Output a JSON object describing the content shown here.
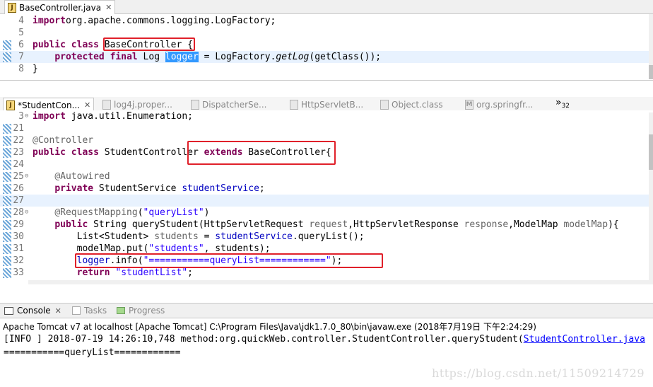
{
  "top_editor": {
    "tab_label": "BaseController.java",
    "lines": [
      {
        "num": "4",
        "parts": [
          [
            "kw",
            "import"
          ],
          [
            "",
            "org.apache.commons.logging.LogFactory;"
          ]
        ]
      },
      {
        "num": "5",
        "parts": []
      },
      {
        "num": "6",
        "parts": [
          [
            "kw",
            "public"
          ],
          [
            "",
            " "
          ],
          [
            "kw",
            "class"
          ],
          [
            "",
            " BaseController {"
          ]
        ]
      },
      {
        "num": "7",
        "parts": [
          [
            "",
            "    "
          ],
          [
            "kw",
            "protected"
          ],
          [
            "",
            " "
          ],
          [
            "kw",
            "final"
          ],
          [
            "",
            " Log "
          ],
          [
            "sel",
            "logger"
          ],
          [
            "",
            " = LogFactory."
          ],
          [
            "it",
            "getLog"
          ],
          [
            "",
            "(getClass());"
          ]
        ]
      },
      {
        "num": "8",
        "parts": [
          [
            "",
            "}"
          ]
        ]
      }
    ]
  },
  "bottom_editor": {
    "tabs": [
      {
        "label": "*StudentCon...",
        "active": true
      },
      {
        "label": "log4j.proper...",
        "active": false
      },
      {
        "label": "DispatcherSe...",
        "active": false
      },
      {
        "label": "HttpServletB...",
        "active": false
      },
      {
        "label": "Object.class",
        "active": false
      },
      {
        "label": "org.springfr...",
        "active": false
      }
    ],
    "overflow_label": "»",
    "overflow_count": "32",
    "lines": [
      {
        "num": "3",
        "parts": [
          [
            "kw",
            "import"
          ],
          [
            "",
            " java.util.Enumeration;"
          ]
        ]
      },
      {
        "num": "21",
        "parts": []
      },
      {
        "num": "22",
        "parts": [
          [
            "ann",
            "@Controller"
          ]
        ]
      },
      {
        "num": "23",
        "parts": [
          [
            "kw",
            "public"
          ],
          [
            "",
            " "
          ],
          [
            "kw",
            "class"
          ],
          [
            "",
            " StudentController "
          ],
          [
            "kw",
            "extends"
          ],
          [
            "",
            " BaseController{"
          ]
        ]
      },
      {
        "num": "24",
        "parts": []
      },
      {
        "num": "25",
        "parts": [
          [
            "",
            "    "
          ],
          [
            "ann",
            "@Autowired"
          ]
        ]
      },
      {
        "num": "26",
        "parts": [
          [
            "",
            "    "
          ],
          [
            "kw",
            "private"
          ],
          [
            "",
            " StudentService "
          ],
          [
            "fld",
            "studentService"
          ],
          [
            "",
            ";"
          ]
        ]
      },
      {
        "num": "27",
        "parts": []
      },
      {
        "num": "28",
        "parts": [
          [
            "",
            "    "
          ],
          [
            "ann",
            "@RequestMapping"
          ],
          [
            "",
            "("
          ],
          [
            "str",
            "\"queryList\""
          ],
          [
            "",
            ")"
          ]
        ]
      },
      {
        "num": "29",
        "parts": [
          [
            "",
            "    "
          ],
          [
            "kw",
            "public"
          ],
          [
            "",
            " String queryStudent(HttpServletRequest "
          ],
          [
            "ann",
            "request"
          ],
          [
            "",
            ",HttpServletResponse "
          ],
          [
            "ann",
            "response"
          ],
          [
            "",
            ",ModelMap "
          ],
          [
            "ann",
            "modelMap"
          ],
          [
            "",
            "){"
          ]
        ]
      },
      {
        "num": "30",
        "parts": [
          [
            "",
            "        List<Student> "
          ],
          [
            "ann",
            "students"
          ],
          [
            "",
            " = "
          ],
          [
            "fld",
            "studentService"
          ],
          [
            "",
            ".queryList();"
          ]
        ]
      },
      {
        "num": "31",
        "parts": [
          [
            "",
            "        modelMap.put("
          ],
          [
            "str",
            "\"students\""
          ],
          [
            "",
            ", students);"
          ]
        ]
      },
      {
        "num": "32",
        "parts": [
          [
            "",
            "        "
          ],
          [
            "fld",
            "logger"
          ],
          [
            "",
            ".info("
          ],
          [
            "str",
            "\"===========queryList============\""
          ],
          [
            "",
            ");"
          ]
        ]
      },
      {
        "num": "33",
        "parts": [
          [
            "",
            "        "
          ],
          [
            "kw",
            "return"
          ],
          [
            "",
            " "
          ],
          [
            "str",
            "\"studentList\""
          ],
          [
            "",
            ";"
          ]
        ]
      }
    ]
  },
  "console": {
    "tabs": [
      {
        "label": "Console",
        "active": true
      },
      {
        "label": "Tasks",
        "active": false
      },
      {
        "label": "Progress",
        "active": false
      }
    ],
    "launch_info": "Apache Tomcat v7 at localhost [Apache Tomcat] C:\\Program Files\\Java\\jdk1.7.0_80\\bin\\javaw.exe (2018年7月19日 下午2:24:29)",
    "log_prefix": "[INFO ] 2018-07-19 14:26:10,748 method:org.quickWeb.controller.StudentController.queryStudent(",
    "log_link": "StudentController.java",
    "log_message": "===========queryList============"
  },
  "watermark": "https://blog.csdn.net/11509214729"
}
